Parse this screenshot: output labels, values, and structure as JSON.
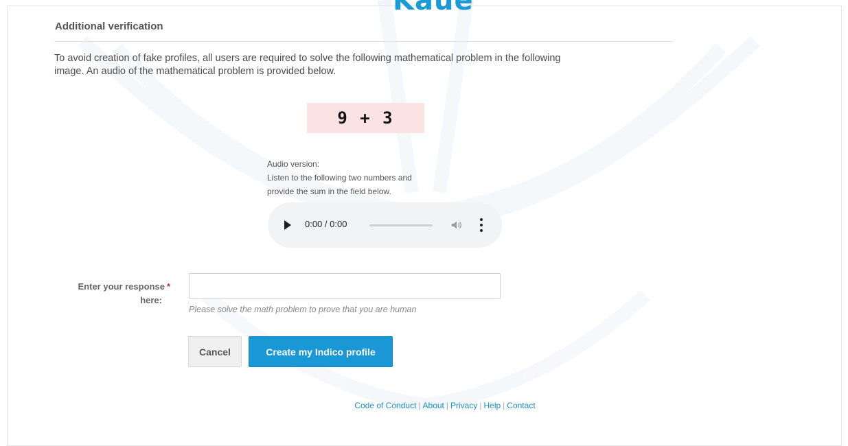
{
  "header": {
    "logo_text": "Kaue"
  },
  "form": {
    "section_title": "Additional verification",
    "intro_line1": "To avoid creation of fake profiles, all users are required to solve the following mathematical problem in the following",
    "intro_line2": "image. An audio of the mathematical problem is provided below.",
    "captcha_text": "9 + 3",
    "audio_title": "Audio version:",
    "audio_line1": "Listen to the following two numbers and",
    "audio_line2": "provide the sum in the field below.",
    "audio_player": {
      "time": "0:00 / 0:00",
      "progress": 0,
      "icons": [
        "play-icon",
        "volume-icon",
        "more-options-icon"
      ]
    },
    "response_label_line1": "Enter your response",
    "response_label_line2": "here:",
    "required_marker": "*",
    "response_value": "",
    "help_text": "Please solve the math problem to prove that you are human",
    "cancel_label": "Cancel",
    "submit_label": "Create my Indico profile"
  },
  "footer": {
    "links": [
      "Code of Conduct",
      "About",
      "Privacy",
      "Help",
      "Contact"
    ],
    "separator": "|"
  },
  "colors": {
    "accent": "#1a98d5",
    "logo": "#1a9ad6",
    "captcha_bg": "#fbe3e3",
    "required": "#c9302c",
    "link": "#1a8fcc"
  }
}
